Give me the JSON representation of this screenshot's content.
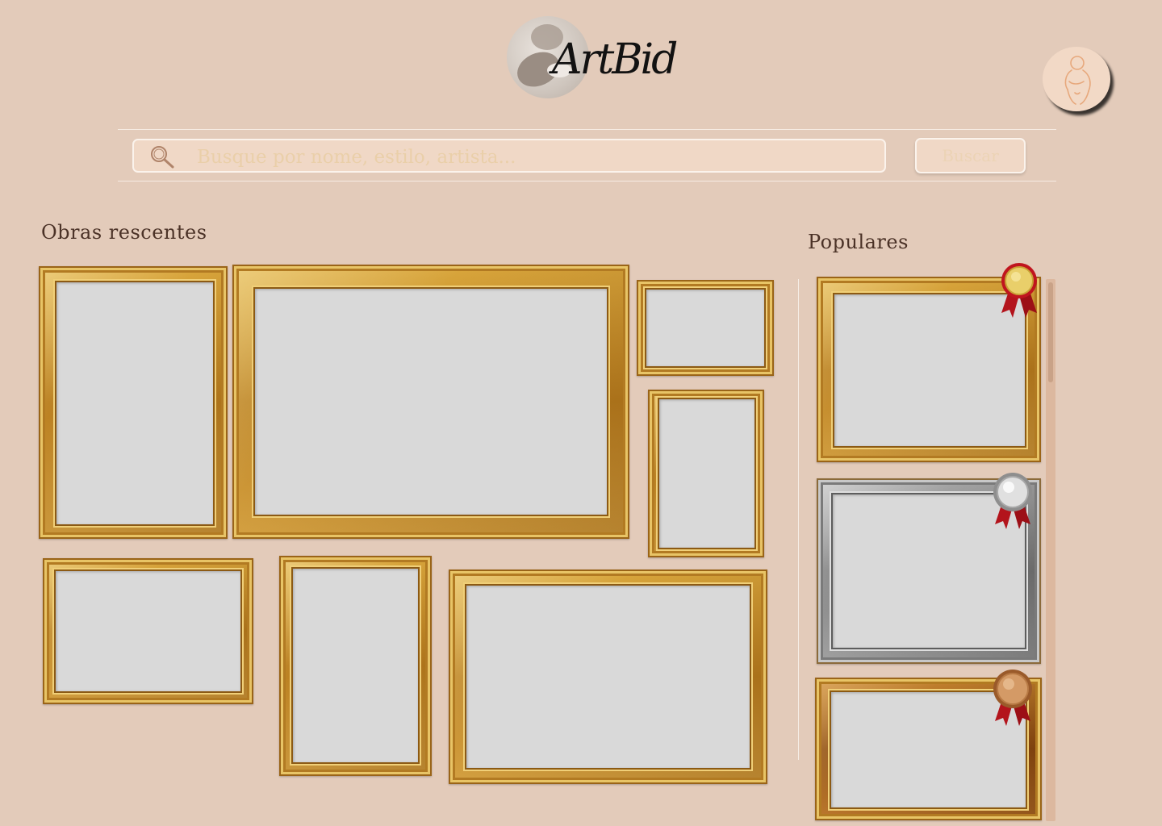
{
  "header": {
    "logo_text": "ArtBid"
  },
  "search": {
    "placeholder": "Busque por nome, estilo, artista...",
    "button_label": "Buscar"
  },
  "recent": {
    "title": "Obras rescentes"
  },
  "popular": {
    "title": "Populares"
  },
  "colors": {
    "background": "#e3cbba",
    "gold": "#c8922e",
    "silver": "#9a9a9a",
    "bronze": "#a86426",
    "canvas": "#d9d9d9"
  }
}
